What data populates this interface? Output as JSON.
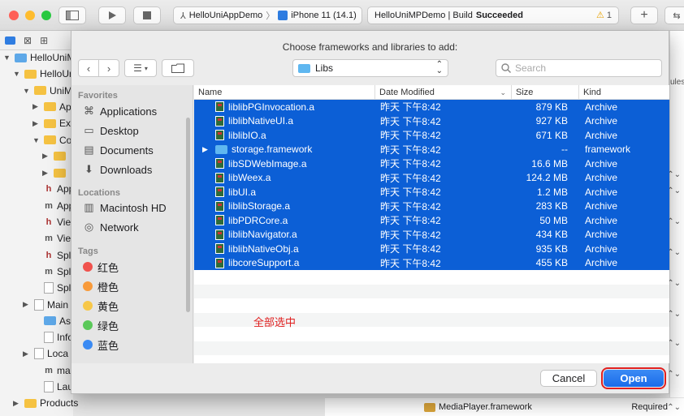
{
  "xcode": {
    "scheme_project": "HelloUniAppDemo",
    "scheme_device": "iPhone 11 (14.1)",
    "status_project": "HelloUniMPDemo | Build",
    "status_result": "Succeeded",
    "warning_count": "1",
    "bottom_file": "MediaPlayer.framework",
    "bottom_embed": "Required",
    "right_edge_text": "ules"
  },
  "navigator": [
    {
      "label": "HelloUniM",
      "icon": "project-icon"
    },
    {
      "label": "HelloUn",
      "icon": "folder-icon"
    },
    {
      "label": "UniM",
      "icon": "folder-icon"
    },
    {
      "label": "Ap",
      "icon": "folder-icon"
    },
    {
      "label": "Ex",
      "icon": "folder-icon"
    },
    {
      "label": "Co",
      "icon": "folder-icon"
    },
    {
      "label": "",
      "icon": "folder-icon"
    },
    {
      "label": "",
      "icon": "folder-icon"
    },
    {
      "label": "Appl",
      "icon": "h-file-icon"
    },
    {
      "label": "Appl",
      "icon": "m-file-icon"
    },
    {
      "label": "View",
      "icon": "h-file-icon"
    },
    {
      "label": "View",
      "icon": "m-file-icon"
    },
    {
      "label": "Spla",
      "icon": "h-file-icon"
    },
    {
      "label": "Spla",
      "icon": "m-file-icon"
    },
    {
      "label": "Spla",
      "icon": "storyboard-icon"
    },
    {
      "label": "Main",
      "icon": "storyboard-icon"
    },
    {
      "label": "Asse",
      "icon": "assets-icon"
    },
    {
      "label": "Info.",
      "icon": "plist-icon"
    },
    {
      "label": "Loca",
      "icon": "strings-icon"
    },
    {
      "label": "main",
      "icon": "m-file-icon"
    },
    {
      "label": "Laur",
      "icon": "storyboard-icon"
    },
    {
      "label": "Products",
      "icon": "folder-icon"
    }
  ],
  "dialog": {
    "title": "Choose frameworks and libraries to add:",
    "location": "Libs",
    "search_placeholder": "Search",
    "cancel_label": "Cancel",
    "open_label": "Open",
    "annotation": "全部选中"
  },
  "sidebar": {
    "favorites_title": "Favorites",
    "favorites": [
      {
        "label": "Applications",
        "icon": "applications-icon"
      },
      {
        "label": "Desktop",
        "icon": "desktop-icon"
      },
      {
        "label": "Documents",
        "icon": "documents-icon"
      },
      {
        "label": "Downloads",
        "icon": "downloads-icon"
      }
    ],
    "locations_title": "Locations",
    "locations": [
      {
        "label": "Macintosh HD",
        "icon": "harddisk-icon"
      },
      {
        "label": "Network",
        "icon": "network-icon"
      }
    ],
    "tags_title": "Tags",
    "tags": [
      {
        "label": "红色",
        "color": "#f0524d"
      },
      {
        "label": "橙色",
        "color": "#f89a3a"
      },
      {
        "label": "黄色",
        "color": "#f7c748"
      },
      {
        "label": "绿色",
        "color": "#5ac859"
      },
      {
        "label": "蓝色",
        "color": "#3a8af3"
      }
    ]
  },
  "columns": {
    "name": "Name",
    "date": "Date Modified",
    "size": "Size",
    "kind": "Kind"
  },
  "files": [
    {
      "name": "liblibPGInvocation.a",
      "date": "昨天 下午8:42",
      "size": "879 KB",
      "kind": "Archive",
      "type": "lib"
    },
    {
      "name": "liblibNativeUI.a",
      "date": "昨天 下午8:42",
      "size": "927 KB",
      "kind": "Archive",
      "type": "lib"
    },
    {
      "name": "liblibIO.a",
      "date": "昨天 下午8:42",
      "size": "671 KB",
      "kind": "Archive",
      "type": "lib"
    },
    {
      "name": "storage.framework",
      "date": "昨天 下午8:42",
      "size": "--",
      "kind": "framework",
      "type": "framework"
    },
    {
      "name": "libSDWebImage.a",
      "date": "昨天 下午8:42",
      "size": "16.6 MB",
      "kind": "Archive",
      "type": "lib"
    },
    {
      "name": "libWeex.a",
      "date": "昨天 下午8:42",
      "size": "124.2 MB",
      "kind": "Archive",
      "type": "lib"
    },
    {
      "name": "libUI.a",
      "date": "昨天 下午8:42",
      "size": "1.2 MB",
      "kind": "Archive",
      "type": "lib"
    },
    {
      "name": "liblibStorage.a",
      "date": "昨天 下午8:42",
      "size": "283 KB",
      "kind": "Archive",
      "type": "lib"
    },
    {
      "name": "libPDRCore.a",
      "date": "昨天 下午8:42",
      "size": "50 MB",
      "kind": "Archive",
      "type": "lib"
    },
    {
      "name": "liblibNavigator.a",
      "date": "昨天 下午8:42",
      "size": "434 KB",
      "kind": "Archive",
      "type": "lib"
    },
    {
      "name": "liblibNativeObj.a",
      "date": "昨天 下午8:42",
      "size": "935 KB",
      "kind": "Archive",
      "type": "lib"
    },
    {
      "name": "libcoreSupport.a",
      "date": "昨天 下午8:42",
      "size": "455 KB",
      "kind": "Archive",
      "type": "lib"
    }
  ],
  "colors": {
    "selection": "#0c5fd6",
    "accent": "#1a6be8",
    "highlight": "#e02020"
  }
}
